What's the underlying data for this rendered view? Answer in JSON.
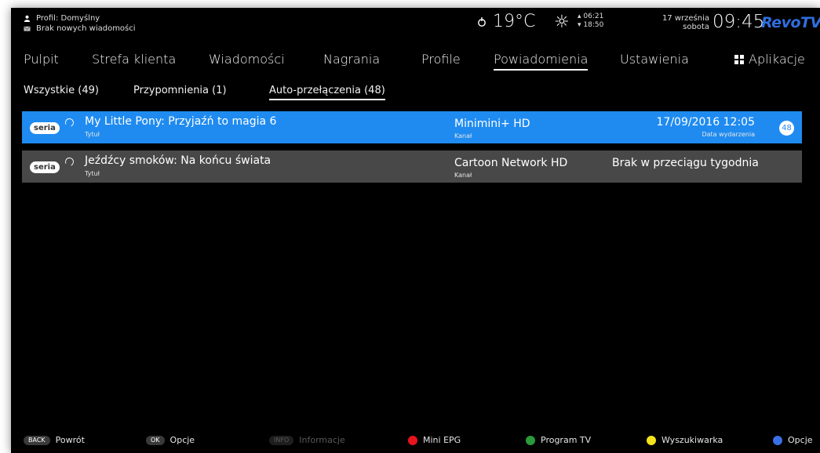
{
  "status": {
    "profile": "Profil: Domyślny",
    "messages": "Brak nowych wiadomości",
    "temperature": "19°C",
    "sunrise": "06:21",
    "sunset": "18:50",
    "date_line1": "17 września",
    "date_line2": "sobota",
    "time": "09:45",
    "logo": "RevoTV"
  },
  "nav": {
    "items": [
      {
        "label": "Pulpit"
      },
      {
        "label": "Strefa klienta"
      },
      {
        "label": "Wiadomości"
      },
      {
        "label": "Nagrania"
      },
      {
        "label": "Profile"
      },
      {
        "label": "Powiadomienia",
        "active": true
      },
      {
        "label": "Ustawienia"
      },
      {
        "label": "Aplikacje"
      }
    ]
  },
  "subnav": {
    "items": [
      {
        "label": "Wszystkie (49)"
      },
      {
        "label": "Przypomnienia (1)"
      },
      {
        "label": "Auto-przełączenia (48)",
        "active": true
      }
    ]
  },
  "list": {
    "rows": [
      {
        "badge": "seria",
        "title": "My Little Pony: Przyjaźń to magia 6",
        "title_label": "Tytuł",
        "channel": "Minimini+ HD",
        "channel_label": "Kanał",
        "date": "17/09/2016 12:05",
        "date_label": "Data wydarzenia",
        "count": "48",
        "selected": true
      },
      {
        "badge": "seria",
        "title": "Jeźdźcy smoków: Na końcu świata",
        "title_label": "Tytuł",
        "channel": "Cartoon Network HD",
        "channel_label": "Kanał",
        "status": "Brak w przeciągu tygodnia"
      }
    ]
  },
  "footer": {
    "back_key": "BACK",
    "back_label": "Powrót",
    "ok_key": "OK",
    "ok_label": "Opcje",
    "info_key": "INFO",
    "info_label": "Informacje",
    "red_label": "Mini EPG",
    "green_label": "Program TV",
    "yellow_label": "Wyszukiwarka",
    "blue_label": "Opcje"
  },
  "colors": {
    "accent_selected": "#1f8bf0",
    "row_default": "#484848",
    "red": "#e8141d",
    "green": "#2a9a3a",
    "yellow": "#f4e21c",
    "blue": "#3a6fe6"
  }
}
